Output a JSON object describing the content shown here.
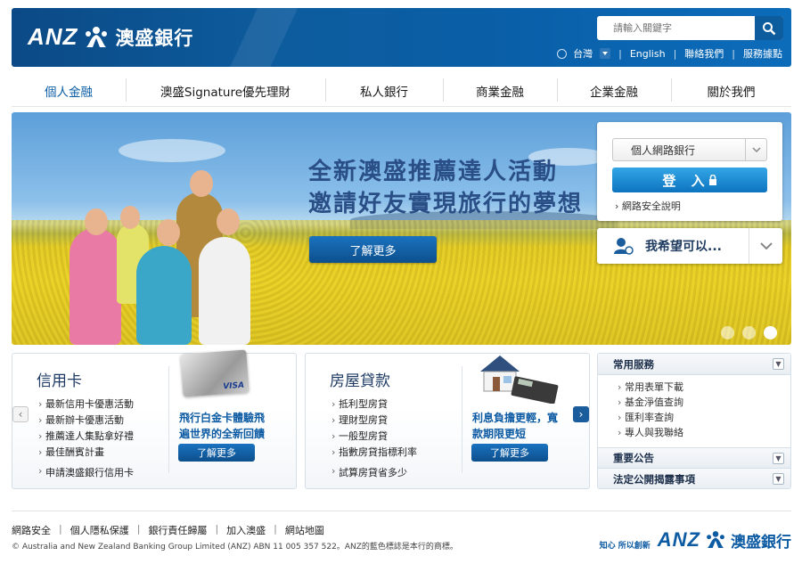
{
  "header": {
    "logo_text": "ANZ",
    "logo_cn": "澳盛銀行",
    "search_placeholder": "請輸入關鍵字",
    "region": "台灣",
    "links": [
      "English",
      "聯絡我們",
      "服務據點"
    ]
  },
  "nav": [
    "個人金融",
    "澳盛Signature優先理財",
    "私人銀行",
    "商業金融",
    "企業金融",
    "關於我們"
  ],
  "hero": {
    "title_line1": "全新澳盛推薦達人活動",
    "title_line2": "邀請好友實現旅行的夢想",
    "button": "了解更多"
  },
  "login": {
    "select_value": "個人網路銀行",
    "button": "登 入",
    "security_link": "網路安全說明"
  },
  "wish": {
    "label": "我希望可以..."
  },
  "credit_card": {
    "title": "信用卡",
    "items": [
      "最新信用卡優惠活動",
      "最新辦卡優惠活動",
      "推薦達人集點拿好禮",
      "最佳酬賓計畫"
    ],
    "extra": "申請澳盛銀行信用卡",
    "promo_line1": "飛行白金卡體驗飛",
    "promo_line2": "遍世界的全新回饋",
    "promo_button": "了解更多",
    "card_label": "VISA"
  },
  "home_loan": {
    "title": "房屋貸款",
    "items": [
      "抵利型房貸",
      "理財型房貸",
      "一般型房貸",
      "指數房貸指標利率"
    ],
    "extra": "試算房貸省多少",
    "promo_line1": "利息負擔更輕，寬",
    "promo_line2": "款期限更短",
    "promo_button": "了解更多"
  },
  "services": {
    "title": "常用服務",
    "items": [
      "常用表單下載",
      "基金淨值查詢",
      "匯利率查詢",
      "專人與我聯絡"
    ],
    "announcements": "重要公告",
    "disclosure": "法定公開揭露事項"
  },
  "footer": {
    "links": [
      "網路安全",
      "個人隱私保護",
      "銀行責任歸屬",
      "加入澳盛",
      "網站地圖"
    ],
    "copyright": "© Australia and New Zealand Banking Group Limited (ANZ) ABN 11 005 357 522。ANZ的藍色標誌是本行的商標。",
    "slogan": "知心 所以創新",
    "logo_text": "ANZ",
    "logo_cn": "澳盛銀行"
  },
  "colors": {
    "brand_blue": "#0d5ba3",
    "header_blue": "#0b4a86",
    "button_blue": "#0d74c0"
  }
}
